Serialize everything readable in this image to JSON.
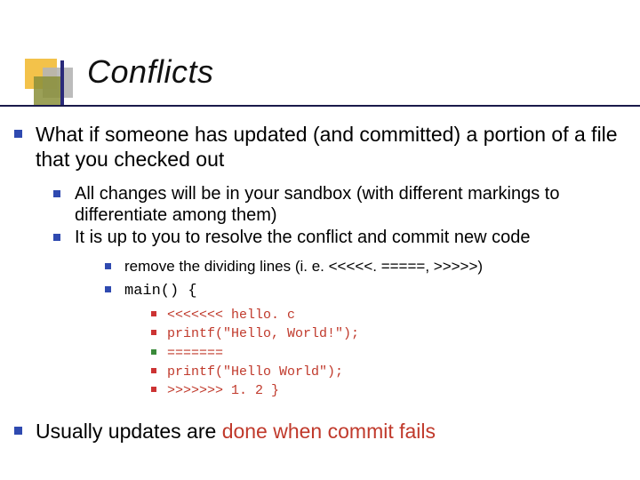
{
  "title": "Conflicts",
  "bullets": {
    "b1": "What if someone has updated (and committed) a portion of a file that you checked out",
    "b1a": "All changes will be in your sandbox (with different markings to differentiate among them)",
    "b1b": "It is up to you to resolve the conflict and commit new code",
    "b1b_i": "remove the dividing lines (i. e. <<<<<. =====, >>>>>)",
    "b1b_ii": "main() {",
    "code": {
      "l1": "<<<<<<< hello. c",
      "l2": "printf(\"Hello, World!\");",
      "l3": "=======",
      "l4": "printf(\"Hello World\");",
      "l5": ">>>>>>> 1. 2 }"
    },
    "b2_pre": "Usually updates are ",
    "b2_red": "done when commit fails"
  }
}
